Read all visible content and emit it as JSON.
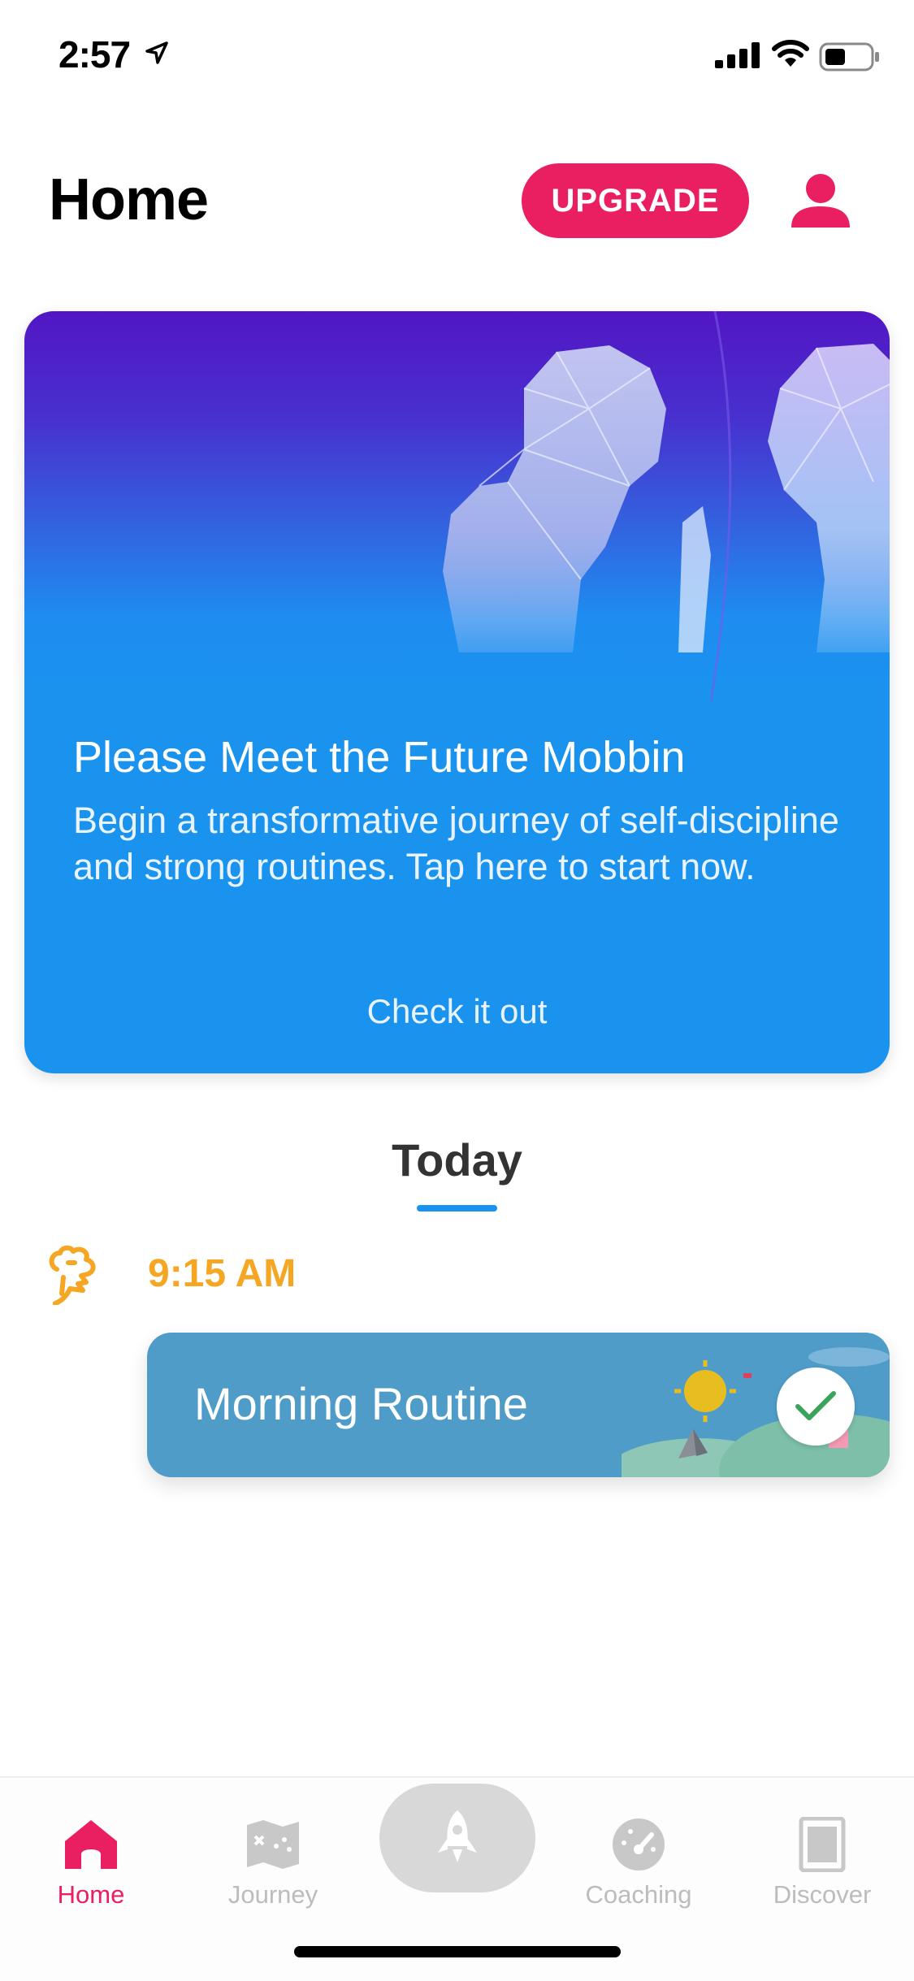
{
  "status_bar": {
    "time": "2:57",
    "icons": [
      "location-arrow-icon",
      "signal-icon",
      "wifi-icon",
      "battery-icon"
    ]
  },
  "header": {
    "title": "Home",
    "upgrade_label": "UPGRADE",
    "profile_icon": "user-icon"
  },
  "hero": {
    "title": "Please Meet the Future Mobbin",
    "description": "Begin a transformative journey of self-discipline and strong routines. Tap here to start now.",
    "cta": "Check it out"
  },
  "today": {
    "label": "Today",
    "time": "9:15 AM",
    "routine": {
      "title": "Morning Routine",
      "completed": true
    }
  },
  "tabs": [
    {
      "label": "Home",
      "icon": "home-icon",
      "active": true
    },
    {
      "label": "Journey",
      "icon": "map-icon",
      "active": false
    },
    {
      "label": "",
      "icon": "rocket-icon",
      "active": false
    },
    {
      "label": "Coaching",
      "icon": "gauge-icon",
      "active": false
    },
    {
      "label": "Discover",
      "icon": "book-icon",
      "active": false
    }
  ],
  "colors": {
    "accent": "#ea1f62",
    "blue": "#1a93ef",
    "time_orange": "#f5a623",
    "routine_card": "#4f9cc9",
    "check_green": "#3ba35a"
  }
}
